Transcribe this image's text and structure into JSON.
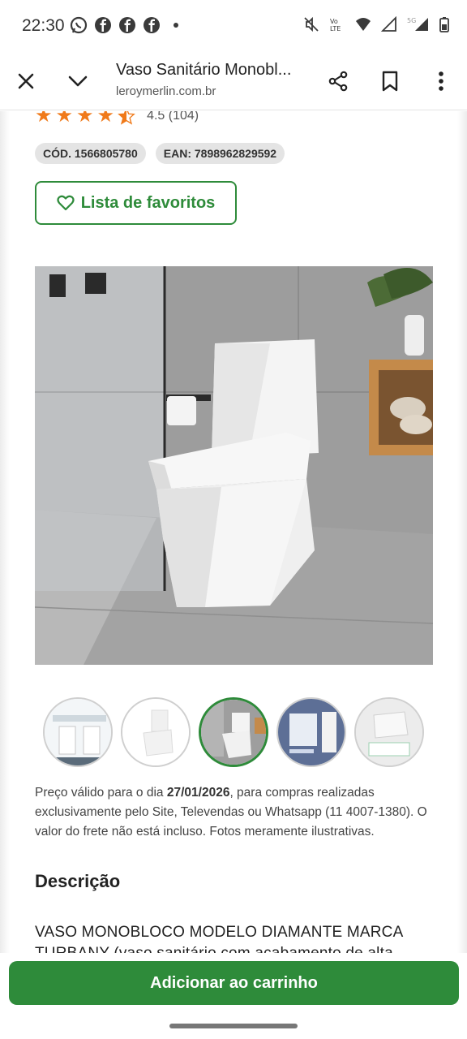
{
  "status_bar": {
    "time": "22:30",
    "left_icons": [
      "whatsapp-icon",
      "facebook-icon",
      "facebook-icon",
      "facebook-icon"
    ],
    "right_icons": [
      "mute-icon",
      "volte-icon",
      "wifi-icon",
      "signal-icon",
      "signal-5g-icon",
      "battery-icon"
    ]
  },
  "browser": {
    "title": "Vaso Sanitário Monobl...",
    "url": "leroymerlin.com.br",
    "icons": [
      "close-icon",
      "chevron-down-icon",
      "share-icon",
      "bookmark-icon",
      "more-vert-icon"
    ]
  },
  "product": {
    "rating_value": 4.5,
    "rating_text": "4.5 (104)",
    "code": "CÓD. 1566805780",
    "ean": "EAN: 7898962829592",
    "favorites_label": "Lista de favoritos",
    "thumbnails": [
      "Product image 1",
      "Product image 2",
      "Product image 3",
      "Product image 4",
      "Product image 5"
    ],
    "active_thumbnail": 3
  },
  "disclaimer": {
    "prefix": "Preço válido para o dia ",
    "date": "27/01/2026",
    "suffix": ", para compras realizadas exclusivamente pelo Site, Televendas ou Whatsapp (11 4007-1380). O valor do frete não está incluso. Fotos meramente ilustrativas."
  },
  "description": {
    "title": "Descrição",
    "text_line1": "VASO MONOBLOCO MODELO DIAMANTE MARCA",
    "text_line2": "TURBANY (vaso sanitário com acabamento de alta"
  },
  "cta": {
    "label": "Adicionar ao carrinho"
  },
  "colors": {
    "brand_green": "#2e8b3a",
    "star_orange": "#f07a1a",
    "chip_bg": "#e4e4e4"
  }
}
